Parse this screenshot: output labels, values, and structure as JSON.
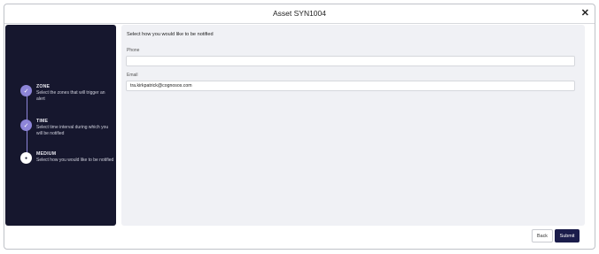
{
  "dialog": {
    "title": "Asset SYN1004",
    "close_glyph": "✕",
    "close_icon": "close-icon"
  },
  "stepper": {
    "steps": [
      {
        "label": "ZONE",
        "description": "Select the zones that will trigger an alert",
        "state": "completed",
        "glyph": "✓"
      },
      {
        "label": "TIME",
        "description": "Select time interval during which you will be notified",
        "state": "completed",
        "glyph": "✓"
      },
      {
        "label": "MEDIUM",
        "description": "Select how you would like to be notified",
        "state": "current",
        "glyph": "●"
      }
    ],
    "colors": {
      "background": "#16172e",
      "accent": "#8d85d8"
    }
  },
  "form": {
    "heading": "Select how you would like to be notified",
    "phone": {
      "label": "Phone",
      "value": ""
    },
    "email": {
      "label": "Email",
      "value": "tra.kirkpatrick@cognosos.com"
    }
  },
  "actions": {
    "back_label": "Back",
    "submit_label": "Submit",
    "submit_color": "#1b1d4b"
  }
}
